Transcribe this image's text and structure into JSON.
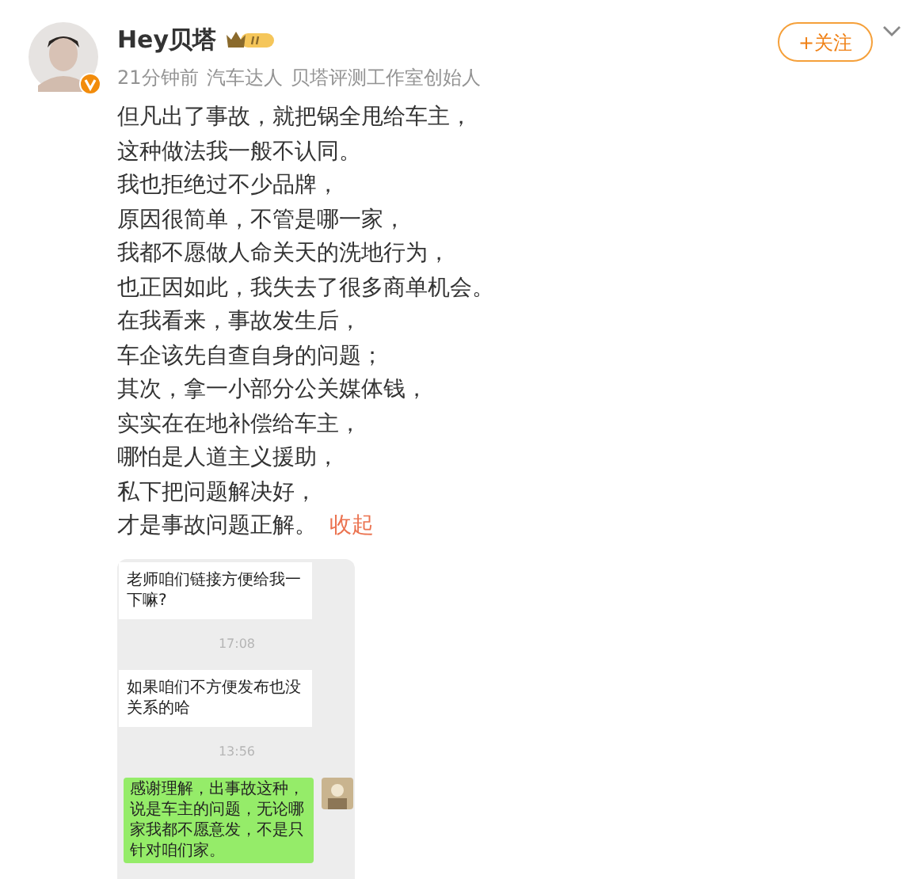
{
  "author": {
    "name": "Hey贝塔",
    "meta": [
      "21分钟前",
      "汽车达人",
      "贝塔评测工作室创始人"
    ]
  },
  "follow_button": "+关注",
  "post": {
    "lines": [
      "但凡出了事故，就把锅全甩给车主，",
      "这种做法我一般不认同。",
      "我也拒绝过不少品牌，",
      "原因很简单，不管是哪一家，",
      "我都不愿做人命关天的洗地行为，",
      "也正因如此，我失去了很多商单机会。",
      "在我看来，事故发生后，",
      "车企该先自查自身的问题；",
      "其次，拿一小部分公关媒体钱，",
      "实实在在地补偿给车主，",
      "哪怕是人道主义援助，",
      "私下把问题解决好，",
      "才是事故问题正解。"
    ],
    "collapse_link": "收起"
  },
  "chat_screenshot": {
    "messages": [
      {
        "kind": "incoming",
        "text": "老师咱们链接方便给我一下嘛?"
      },
      {
        "kind": "time",
        "text": "17:08"
      },
      {
        "kind": "incoming",
        "text": "如果咱们不方便发布也没关系的哈"
      },
      {
        "kind": "time",
        "text": "13:56"
      },
      {
        "kind": "outgoing",
        "text": "感谢理解，出事故这种，说是车主的问题，无论哪家我都不愿意发，不是只针对咱们家。"
      }
    ]
  }
}
